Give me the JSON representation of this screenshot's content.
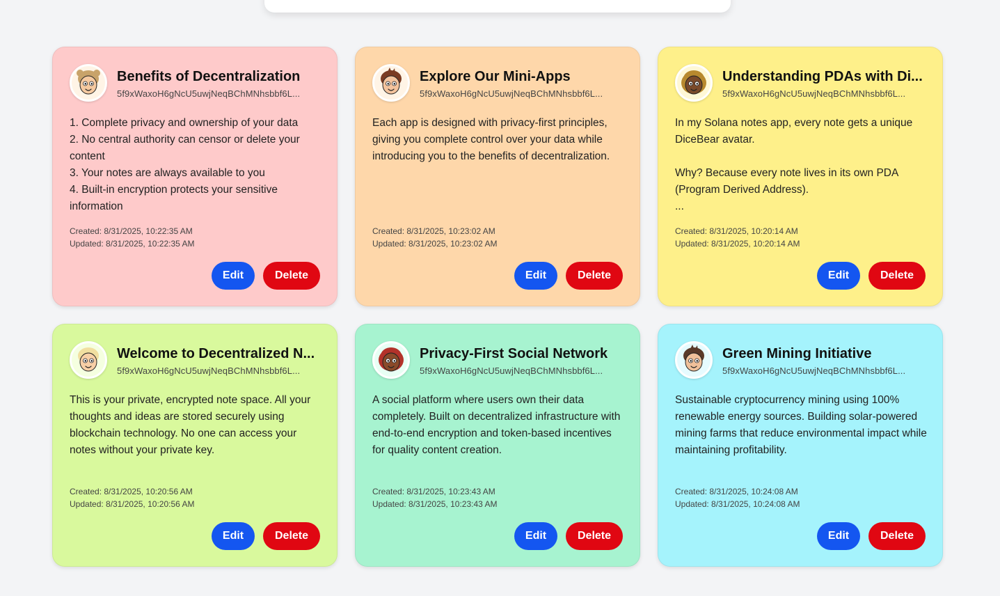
{
  "notes": [
    {
      "title": "Benefits of Decentralization",
      "address": "5f9xWaxoH6gNcU5uwjNeqBChMNhsbbf6L...",
      "body": "1. Complete privacy and ownership of your data\n2. No central authority can censor or delete your content\n3. Your notes are always available to you\n4. Built-in encryption protects your sensitive information",
      "created": "Created: 8/31/2025, 10:22:35 AM",
      "updated": "Updated: 8/31/2025, 10:22:35 AM",
      "color": "#fecaca",
      "edit_label": "Edit",
      "delete_label": "Delete"
    },
    {
      "title": "Explore Our Mini-Apps",
      "address": "5f9xWaxoH6gNcU5uwjNeqBChMNhsbbf6L...",
      "body": "Each app is designed with privacy-first principles, giving you complete control over your data while introducing you to the benefits of decentralization.",
      "created": "Created: 8/31/2025, 10:23:02 AM",
      "updated": "Updated: 8/31/2025, 10:23:02 AM",
      "color": "#fed7aa",
      "edit_label": "Edit",
      "delete_label": "Delete"
    },
    {
      "title": "Understanding PDAs with Di...",
      "address": "5f9xWaxoH6gNcU5uwjNeqBChMNhsbbf6L...",
      "body": "In my Solana notes app, every note gets a unique DiceBear avatar.\n\nWhy? Because every note lives in its own PDA (Program Derived Address).\n...",
      "created": "Created: 8/31/2025, 10:20:14 AM",
      "updated": "Updated: 8/31/2025, 10:20:14 AM",
      "color": "#fef08a",
      "edit_label": "Edit",
      "delete_label": "Delete"
    },
    {
      "title": "Welcome to Decentralized N...",
      "address": "5f9xWaxoH6gNcU5uwjNeqBChMNhsbbf6L...",
      "body": "This is your private, encrypted note space. All your thoughts and ideas are stored securely using blockchain technology. No one can access your notes without your private key.",
      "created": "Created: 8/31/2025, 10:20:56 AM",
      "updated": "Updated: 8/31/2025, 10:20:56 AM",
      "color": "#d9f99d",
      "edit_label": "Edit",
      "delete_label": "Delete"
    },
    {
      "title": "Privacy-First Social Network",
      "address": "5f9xWaxoH6gNcU5uwjNeqBChMNhsbbf6L...",
      "body": "A social platform where users own their data completely. Built on decentralized infrastructure with end-to-end encryption and token-based incentives for quality content creation.",
      "created": "Created: 8/31/2025, 10:23:43 AM",
      "updated": "Updated: 8/31/2025, 10:23:43 AM",
      "color": "#a7f3d0",
      "edit_label": "Edit",
      "delete_label": "Delete"
    },
    {
      "title": "Green Mining Initiative",
      "address": "5f9xWaxoH6gNcU5uwjNeqBChMNhsbbf6L...",
      "body": "Sustainable cryptocurrency mining using 100% renewable energy sources. Building solar-powered mining farms that reduce environmental impact while maintaining profitability.",
      "created": "Created: 8/31/2025, 10:24:08 AM",
      "updated": "Updated: 8/31/2025, 10:24:08 AM",
      "color": "#a5f3fc",
      "edit_label": "Edit",
      "delete_label": "Delete"
    }
  ],
  "avatars": [
    {
      "icon": "avatar-girl-buns-icon",
      "skin": "#f5c9a0",
      "hair": "#c8a36a",
      "bg": "#fff4e6"
    },
    {
      "icon": "avatar-boy-spiky-icon",
      "skin": "#f3c39d",
      "hair": "#7a3b22",
      "bg": "#fff4e6"
    },
    {
      "icon": "avatar-dark-curly-icon",
      "skin": "#7a4a2a",
      "hair": "#b8892e",
      "bg": "#fff8d6"
    },
    {
      "icon": "avatar-blond-boy-icon",
      "skin": "#f7cfa6",
      "hair": "#f1dfa0",
      "bg": "#f5ffe0"
    },
    {
      "icon": "avatar-red-hair-icon",
      "skin": "#8a4a2a",
      "hair": "#b3322a",
      "bg": "#e8fff4"
    },
    {
      "icon": "avatar-boy-mohawk-icon",
      "skin": "#f0c09a",
      "hair": "#5a3a2a",
      "bg": "#e6fbff"
    }
  ]
}
